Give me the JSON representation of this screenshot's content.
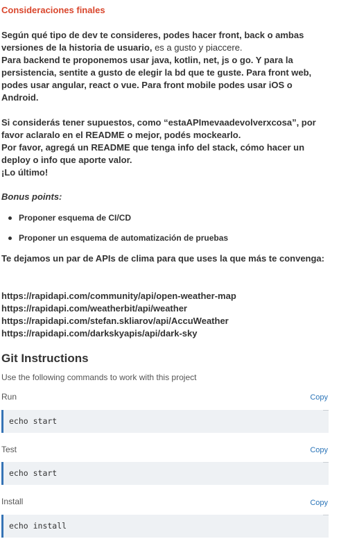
{
  "final": {
    "title": "Consideraciones finales",
    "p1_bold": "Según qué tipo de dev te consideres, podes hacer front, back o ambas versiones de la historia de usuario,",
    "p1_normal": " es a gusto y piaccere.",
    "p2": "Para backend te proponemos usar java, kotlin, net, js o go. Y para la persistencia, sentite a gusto de elegir la bd que te guste. Para front web, podes usar angular, react o vue. Para front mobile podes usar iOS o Android.",
    "p3": "Si considerás tener supuestos, como “estaAPImevaadevolverxcosa”, por favor aclaralo en el README o mejor, podés mockearlo.",
    "p4": "Por favor, agregá un README que tenga info del stack, cómo hacer un deploy o info que aporte valor.",
    "p5": "¡Lo último!",
    "bonus_title": "Bonus points:",
    "bonus_items": [
      "Proponer esquema de CI/CD",
      "Proponer un esquema de automatización de pruebas"
    ],
    "apis_intro": "Te dejamos un par de APIs de clima para que uses la que más te convenga:",
    "apis": [
      "https://rapidapi.com/community/api/open-weather-map",
      "https://rapidapi.com/weatherbit/api/weather",
      "https://rapidapi.com/stefan.skliarov/api/AccuWeather",
      "https://rapidapi.com/darkskyapis/api/dark-sky"
    ]
  },
  "git": {
    "title": "Git Instructions",
    "subtitle": "Use the following commands to work with this project",
    "copy_label": "Copy",
    "commands": [
      {
        "label": "Run",
        "code": "echo start"
      },
      {
        "label": "Test",
        "code": "echo start"
      },
      {
        "label": "Install",
        "code": "echo install"
      }
    ]
  },
  "colors": {
    "accent": "#d9462c",
    "link": "#2a74b8",
    "code_border": "#3573b5",
    "code_bg": "#eef1f4"
  }
}
